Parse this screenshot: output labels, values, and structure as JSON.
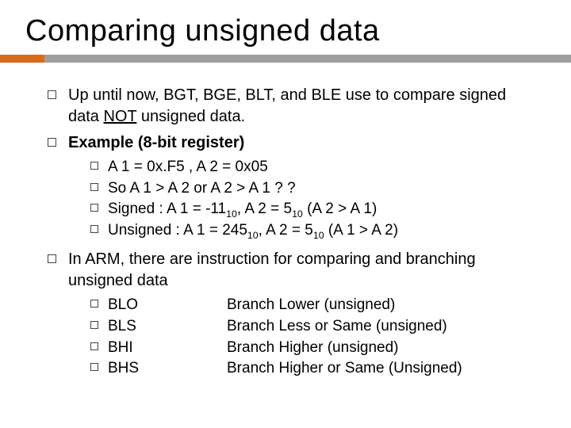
{
  "title": "Comparing unsigned data",
  "bullets": {
    "b1": "Up until now, BGT, BGE, BLT, and BLE use to compare signed data ",
    "b1_not": "NOT",
    "b1_tail": " unsigned data.",
    "b2": "Example (8-bit register)",
    "b2_sub": {
      "s1": "A 1 = 0x.F5 , A 2 = 0x05",
      "s2": "So  A 1 > A 2   or  A 2 > A 1 ? ?",
      "s3_a": "Signed :  A 1 = -11",
      "s3_b": ",  A 2 = 5",
      "s3_c": "    (A 2  > A 1)",
      "s4_a": "Unsigned :  A 1 = 245",
      "s4_b": ", A 2 = 5",
      "s4_c": " (A 1  > A 2)",
      "sub10": "10"
    },
    "b3": "In ARM, there are instruction for comparing and branching unsigned data",
    "b3_sub": [
      {
        "mnemonic": "BLO",
        "desc": "Branch Lower (unsigned)"
      },
      {
        "mnemonic": "BLS",
        "desc": "Branch Less or Same (unsigned)"
      },
      {
        "mnemonic": "BHI",
        "desc": "Branch Higher (unsigned)"
      },
      {
        "mnemonic": "BHS",
        "desc": "Branch Higher or Same (Unsigned)"
      }
    ]
  }
}
